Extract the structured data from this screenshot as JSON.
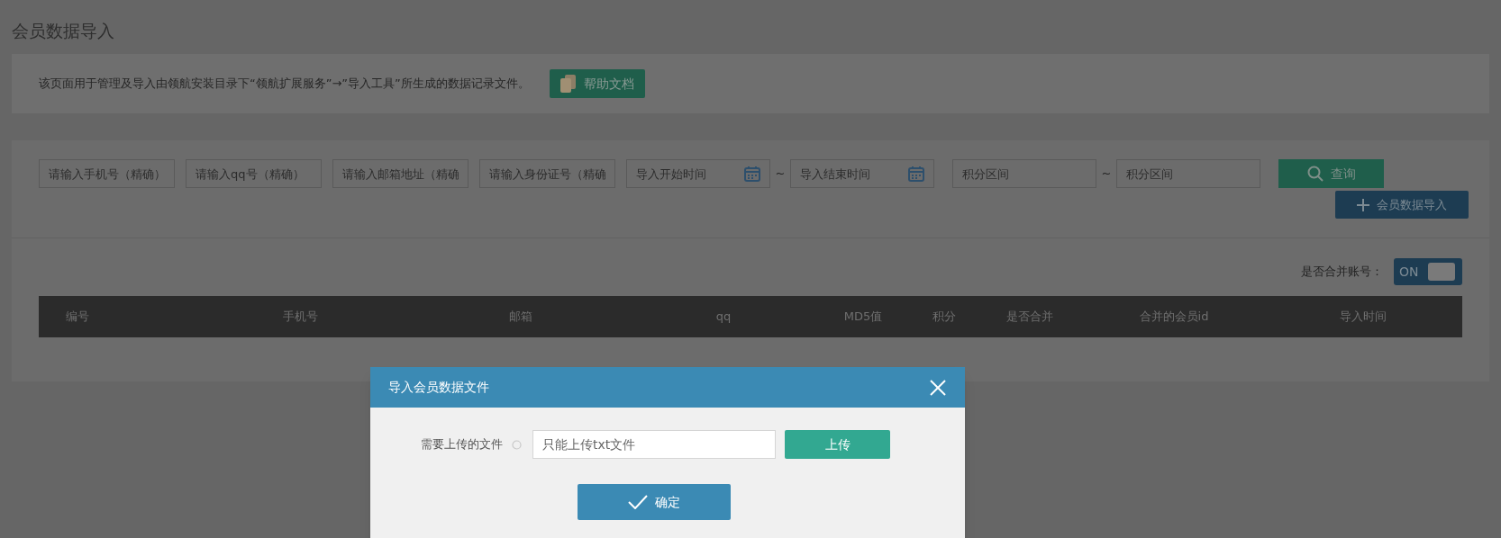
{
  "page_title": "会员数据导入",
  "notice": {
    "text": "该页面用于管理及导入由领航安装目录下“领航扩展服务”→”导入工具”所生成的数据记录文件。",
    "help_button": "帮助文档"
  },
  "filters": [
    {
      "kind": "text",
      "placeholder": "请输入手机号（精确）"
    },
    {
      "kind": "text",
      "placeholder": "请输入qq号（精确）"
    },
    {
      "kind": "text",
      "placeholder": "请输入邮箱地址（精确"
    },
    {
      "kind": "text",
      "placeholder": "请输入身份证号（精确"
    },
    {
      "kind": "date",
      "placeholder": "导入开始时间"
    },
    {
      "kind": "separator",
      "text": "~"
    },
    {
      "kind": "date",
      "placeholder": "导入结束时间"
    },
    {
      "kind": "text",
      "placeholder": "积分区间"
    },
    {
      "kind": "separator",
      "text": "~"
    },
    {
      "kind": "text",
      "placeholder": "积分区间"
    }
  ],
  "search_button": "查询",
  "import_button": "会员数据导入",
  "merge_toggle": {
    "label": "是否合并账号：",
    "text": "ON",
    "on": true
  },
  "table": {
    "columns": [
      "编号",
      "手机号",
      "邮箱",
      "qq",
      "MD5值",
      "积分",
      "是否合并",
      "合并的会员id",
      "导入时间"
    ]
  },
  "dialog": {
    "title": "导入会员数据文件",
    "field_label": "需要上传的文件",
    "field_placeholder": "只能上传txt文件",
    "upload_button": "上传",
    "confirm_button": "确定"
  }
}
